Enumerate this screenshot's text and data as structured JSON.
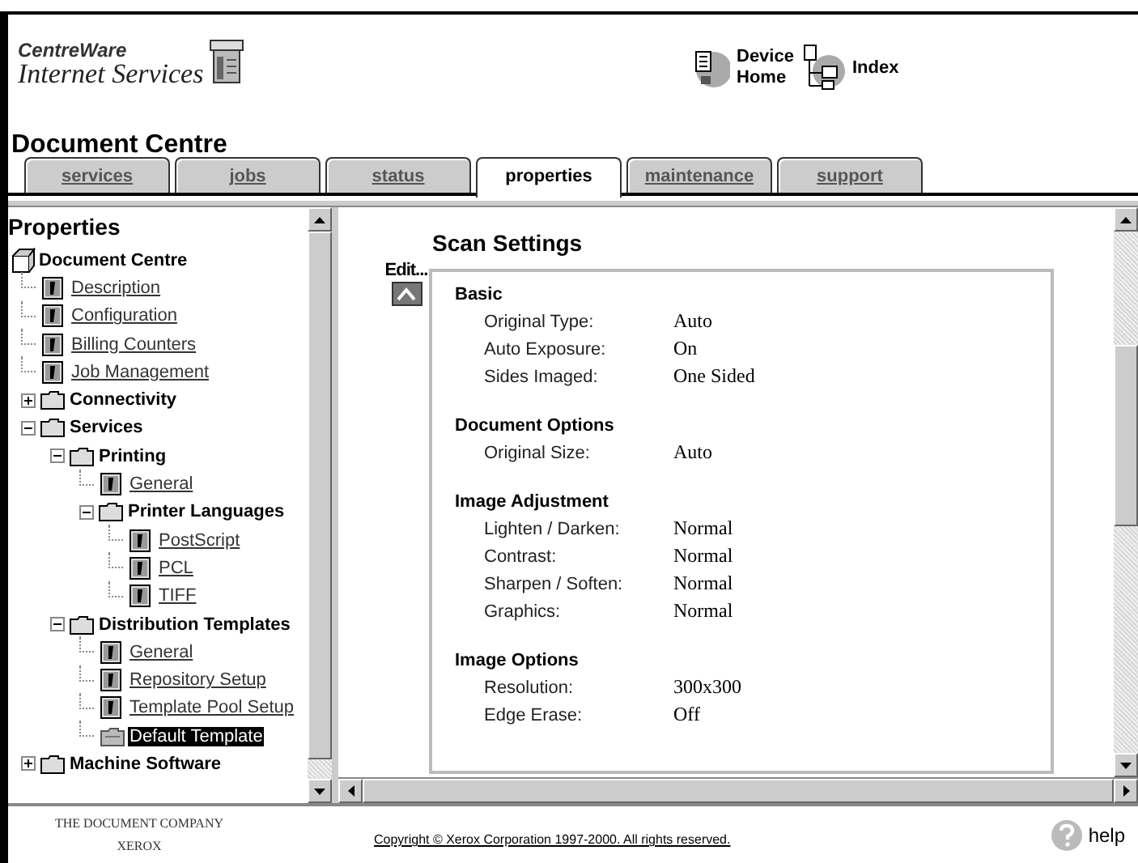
{
  "header": {
    "brand_line_1": "CentreWare",
    "brand_line_2": "Internet Services",
    "title": "Document Centre",
    "links": [
      {
        "kind": "device-home",
        "label_1": "Device",
        "label_2": "Home"
      },
      {
        "kind": "index",
        "label_1": "Index"
      }
    ]
  },
  "tabs": [
    {
      "label": "services",
      "selected": false
    },
    {
      "label": "jobs",
      "selected": false
    },
    {
      "label": "status",
      "selected": false
    },
    {
      "label": "properties",
      "selected": true
    },
    {
      "label": "maintenance",
      "selected": false
    },
    {
      "label": "support",
      "selected": false
    }
  ],
  "sidebar": {
    "title": "Properties",
    "tree": [
      {
        "kind": "root",
        "label": "Document Centre",
        "selected": false,
        "children": [
          {
            "kind": "page",
            "label": "Description",
            "selected": false
          },
          {
            "kind": "page",
            "label": "Configuration",
            "selected": false
          },
          {
            "kind": "page",
            "label": "Billing Counters",
            "selected": false
          },
          {
            "kind": "page",
            "label": "Job Management",
            "selected": false
          },
          {
            "kind": "folder",
            "label": "Connectivity",
            "expanded": false,
            "selected": false
          },
          {
            "kind": "folder",
            "label": "Services",
            "expanded": true,
            "selected": false,
            "children": [
              {
                "kind": "folder",
                "label": "Printing",
                "expanded": true,
                "selected": false,
                "children": [
                  {
                    "kind": "page",
                    "label": "General",
                    "selected": false
                  },
                  {
                    "kind": "folder",
                    "label": "Printer Languages",
                    "expanded": true,
                    "selected": false,
                    "children": [
                      {
                        "kind": "page",
                        "label": "PostScript",
                        "selected": false
                      },
                      {
                        "kind": "page",
                        "label": "PCL",
                        "selected": false
                      },
                      {
                        "kind": "page",
                        "label": "TIFF",
                        "selected": false
                      }
                    ]
                  }
                ]
              },
              {
                "kind": "folder",
                "label": "Distribution Templates",
                "expanded": true,
                "selected": false,
                "children": [
                  {
                    "kind": "page",
                    "label": "General",
                    "selected": false
                  },
                  {
                    "kind": "page",
                    "label": "Repository Setup",
                    "selected": false
                  },
                  {
                    "kind": "page",
                    "label": "Template Pool Setup",
                    "selected": false
                  },
                  {
                    "kind": "template",
                    "label": "Default Template",
                    "selected": true
                  }
                ]
              }
            ]
          },
          {
            "kind": "folder",
            "label": "Machine Software",
            "expanded": false,
            "selected": false
          }
        ]
      }
    ]
  },
  "content": {
    "title": "Scan Settings",
    "edit_label": "Edit...",
    "sections": [
      {
        "title": "Basic",
        "rows": [
          {
            "label": "Original Type:",
            "value": "Auto"
          },
          {
            "label": "Auto Exposure:",
            "value": "On"
          },
          {
            "label": "Sides Imaged:",
            "value": "One Sided"
          }
        ]
      },
      {
        "title": "Document Options",
        "rows": [
          {
            "label": "Original Size:",
            "value": "Auto"
          }
        ]
      },
      {
        "title": "Image Adjustment",
        "rows": [
          {
            "label": "Lighten / Darken:",
            "value": "Normal"
          },
          {
            "label": "Contrast:",
            "value": "Normal"
          },
          {
            "label": "Sharpen / Soften:",
            "value": "Normal"
          },
          {
            "label": "Graphics:",
            "value": "Normal"
          }
        ]
      },
      {
        "title": "Image Options",
        "rows": [
          {
            "label": "Resolution:",
            "value": "300x300"
          },
          {
            "label": "Edge Erase:",
            "value": "Off"
          }
        ]
      }
    ]
  },
  "footer": {
    "company_line_1": "THE DOCUMENT COMPANY",
    "company_line_2": "XEROX",
    "copyright": "Copyright © Xerox Corporation 1997-2000. All rights reserved.",
    "help": "help"
  }
}
